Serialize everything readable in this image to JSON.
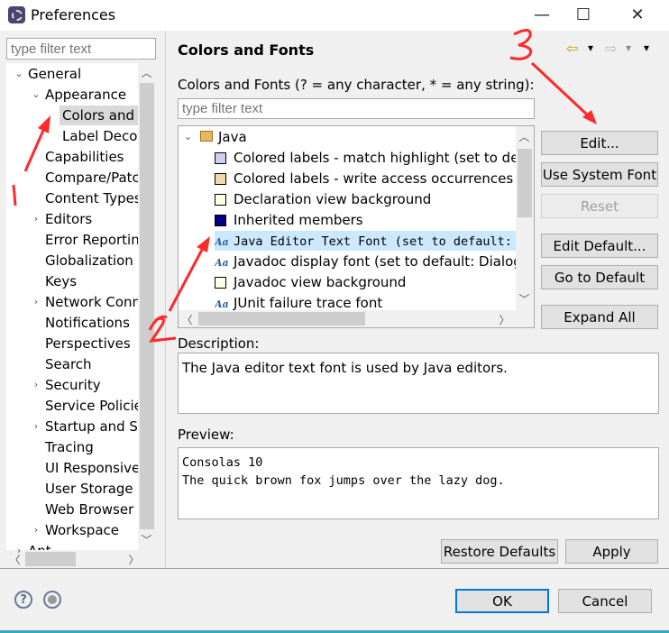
{
  "window": {
    "title": "Preferences",
    "minimize": "—",
    "maximize": "☐",
    "close": "✕"
  },
  "left": {
    "filter_placeholder": "type filter text",
    "tree": [
      {
        "label": "General",
        "level": 0,
        "expander": "expanded"
      },
      {
        "label": "Appearance",
        "level": 1,
        "expander": "expanded"
      },
      {
        "label": "Colors and",
        "level": 2,
        "selected": true
      },
      {
        "label": "Label Decor",
        "level": 2
      },
      {
        "label": "Capabilities",
        "level": 1
      },
      {
        "label": "Compare/Patc",
        "level": 1
      },
      {
        "label": "Content Types",
        "level": 1
      },
      {
        "label": "Editors",
        "level": 1,
        "expander": "collapsed"
      },
      {
        "label": "Error Reportin",
        "level": 1
      },
      {
        "label": "Globalization",
        "level": 1
      },
      {
        "label": "Keys",
        "level": 1
      },
      {
        "label": "Network Conn",
        "level": 1,
        "expander": "collapsed"
      },
      {
        "label": "Notifications",
        "level": 1
      },
      {
        "label": "Perspectives",
        "level": 1
      },
      {
        "label": "Search",
        "level": 1
      },
      {
        "label": "Security",
        "level": 1,
        "expander": "collapsed"
      },
      {
        "label": "Service Policie",
        "level": 1
      },
      {
        "label": "Startup and Sh",
        "level": 1,
        "expander": "collapsed"
      },
      {
        "label": "Tracing",
        "level": 1
      },
      {
        "label": "UI Responsive",
        "level": 1
      },
      {
        "label": "User Storage S",
        "level": 1
      },
      {
        "label": "Web Browser",
        "level": 1
      },
      {
        "label": "Workspace",
        "level": 1,
        "expander": "collapsed"
      },
      {
        "label": "Ant",
        "level": 0,
        "expander": "collapsed"
      }
    ]
  },
  "main": {
    "title": "Colors and Fonts",
    "nav": {
      "back": "⇦",
      "forward": "⇨",
      "menu": "▾"
    },
    "filter_label": "Colors and Fonts (? = any character, * = any string):",
    "filter_placeholder": "type filter text",
    "category": "Java",
    "items": [
      {
        "label": "Colored labels - match highlight (set to def",
        "type": "color",
        "color": "#d0cdf0"
      },
      {
        "label": "Colored labels - write access occurrences",
        "type": "color",
        "color": "#f0d8a8"
      },
      {
        "label": "Declaration view background",
        "type": "color",
        "color": "#ffffe6"
      },
      {
        "label": "Inherited members",
        "type": "color",
        "color": "#000080"
      },
      {
        "label": "Java Editor Text Font (set to default: ",
        "type": "font",
        "selected": true,
        "mono": true
      },
      {
        "label": "Javadoc display font (set to default: Dialog",
        "type": "font"
      },
      {
        "label": "Javadoc view background",
        "type": "color",
        "color": "#ffffe6"
      },
      {
        "label": "JUnit failure trace font",
        "type": "font"
      }
    ],
    "font_icon_text": "Aa",
    "buttons": {
      "edit": "Edit...",
      "use_system_font": "Use System Font",
      "reset": "Reset",
      "edit_default": "Edit Default...",
      "go_to_default": "Go to Default",
      "expand_all": "Expand All"
    },
    "description_label": "Description:",
    "description": "The Java editor text font is used by Java editors.",
    "preview_label": "Preview:",
    "preview_lines": [
      "Consolas 10",
      "The quick brown fox jumps over the lazy dog."
    ],
    "restore_defaults": "Restore Defaults",
    "apply": "Apply"
  },
  "footer": {
    "help": "?",
    "ok": "OK",
    "cancel": "Cancel"
  },
  "annotations": {
    "color": "#ff2a2a",
    "labels": [
      "1",
      "2",
      "3"
    ]
  }
}
